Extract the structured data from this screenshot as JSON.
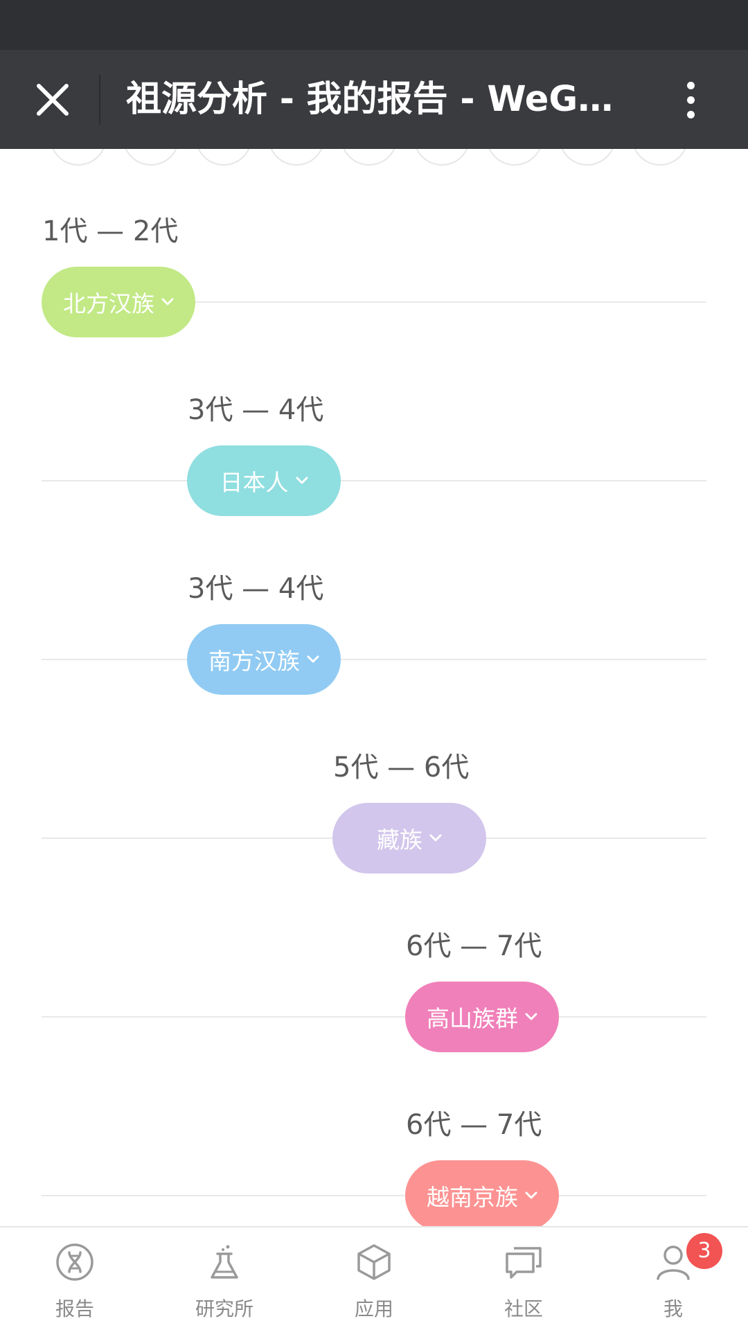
{
  "header": {
    "title": "祖源分析 - 我的报告 - WeGen…",
    "close_icon": "close-icon",
    "more_icon": "more-vertical-icon"
  },
  "timeline": [
    {
      "generation": "1代 — 2代",
      "population": "北方汉族",
      "color": "#c2e985"
    },
    {
      "generation": "3代 — 4代",
      "population": "日本人",
      "color": "#8fdee0"
    },
    {
      "generation": "3代 — 4代",
      "population": "南方汉族",
      "color": "#91cbf3"
    },
    {
      "generation": "5代 — 6代",
      "population": "藏族",
      "color": "#d2c6ec"
    },
    {
      "generation": "6代 — 7代",
      "population": "高山族群",
      "color": "#f080b9"
    },
    {
      "generation": "6代 — 7代",
      "population": "越南京族",
      "color": "#fc9392"
    }
  ],
  "tabbar": {
    "items": [
      {
        "label": "报告",
        "icon": "dna-icon"
      },
      {
        "label": "研究所",
        "icon": "flask-icon"
      },
      {
        "label": "应用",
        "icon": "cube-icon"
      },
      {
        "label": "社区",
        "icon": "chat-icon"
      },
      {
        "label": "我",
        "icon": "person-icon",
        "badge": "3"
      }
    ]
  }
}
